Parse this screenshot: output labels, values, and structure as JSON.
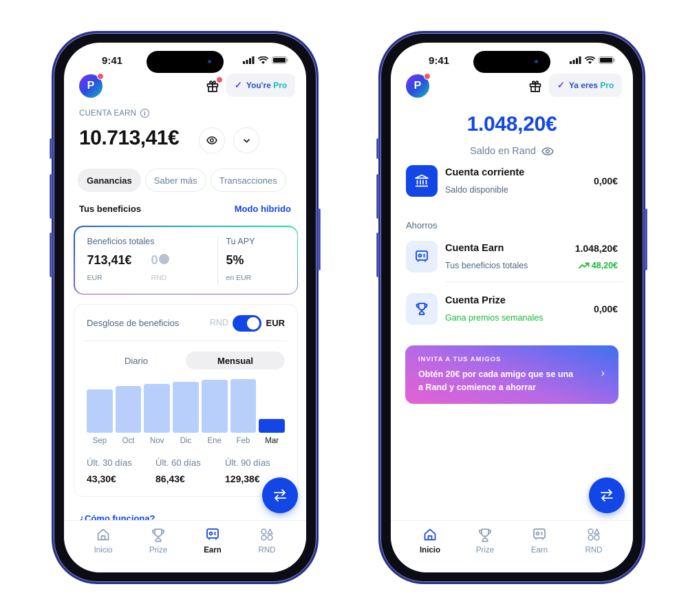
{
  "status_bar": {
    "time": "9:41"
  },
  "left_screen": {
    "avatar_initial": "P",
    "pro_badge": {
      "prefix": "You're",
      "suffix": "Pro"
    },
    "account_label": "CUENTA EARN",
    "balance": "10.713,41€",
    "tabs": [
      {
        "label": "Ganancias",
        "active": true
      },
      {
        "label": "Saber más",
        "active": false
      },
      {
        "label": "Transacciones",
        "active": false
      }
    ],
    "benefits_title": "Tus beneficios",
    "benefits_link": "Modo híbrido",
    "benefits_card": {
      "total_label": "Beneficios totales",
      "total_value": "713,41€",
      "total_unit": "EUR",
      "rnd_value": "0",
      "rnd_unit": "RND",
      "apy_label": "Tu APY",
      "apy_value": "5%",
      "apy_unit": "en EUR"
    },
    "breakdown": {
      "title": "Desglose de beneficios",
      "toggle_left": "RND",
      "toggle_right": "EUR",
      "toggle_on": true,
      "segments": [
        {
          "label": "Diario",
          "active": false
        },
        {
          "label": "Mensual",
          "active": true
        }
      ],
      "stats": [
        {
          "label": "Últ. 30 días",
          "value": "43,30€"
        },
        {
          "label": "Últ. 60 días",
          "value": "86,43€"
        },
        {
          "label": "Últ. 90 días",
          "value": "129,38€"
        }
      ]
    },
    "how_link": "¿Cómo funciona?",
    "nav": [
      {
        "label": "Inicio",
        "icon": "home-icon",
        "active": false
      },
      {
        "label": "Prize",
        "icon": "trophy-icon",
        "active": false
      },
      {
        "label": "Earn",
        "icon": "safe-icon",
        "active": true
      },
      {
        "label": "RND",
        "icon": "shapes-icon",
        "active": false
      }
    ]
  },
  "right_screen": {
    "avatar_initial": "P",
    "pro_badge": {
      "prefix": "Ya eres",
      "suffix": "Pro"
    },
    "balance": "1.048,20€",
    "balance_label": "Saldo en Rand",
    "current_account": {
      "name": "Cuenta corriente",
      "desc": "Saldo disponible",
      "amount": "0,00€"
    },
    "savings_label": "Ahorros",
    "earn_account": {
      "name": "Cuenta Earn",
      "desc": "Tus beneficios totales",
      "amount": "1.048,20€",
      "gain": "48,20€"
    },
    "prize_account": {
      "name": "Cuenta Prize",
      "desc": "Gana premios semanales",
      "amount": "0,00€"
    },
    "promo": {
      "kicker": "INVITA A TUS AMIGOS",
      "message": "Obtén 20€ por cada amigo que se una a Rand y comience a ahorrar"
    },
    "nav": [
      {
        "label": "Inicio",
        "icon": "home-icon",
        "active": true
      },
      {
        "label": "Prize",
        "icon": "trophy-icon",
        "active": false
      },
      {
        "label": "Earn",
        "icon": "safe-icon",
        "active": false
      },
      {
        "label": "RND",
        "icon": "shapes-icon",
        "active": false
      }
    ]
  },
  "chart_data": {
    "type": "bar",
    "title": "Desglose de beneficios",
    "categories": [
      "Sep",
      "Oct",
      "Nov",
      "Dic",
      "Ene",
      "Feb",
      "Mar"
    ],
    "values": [
      0.76,
      0.82,
      0.85,
      0.89,
      0.92,
      0.94,
      0.24
    ],
    "value_note": "relative monthly earnings (unlabeled axis, normalized to max ≈ 1)",
    "highlighted": "Mar",
    "xlabel": "",
    "ylabel": "",
    "colors": {
      "bar": "#b8cffb",
      "highlight": "#1246e6"
    }
  },
  "colors": {
    "accent": "#1246e6",
    "positive": "#19b83a",
    "muted": "#6c8197"
  }
}
